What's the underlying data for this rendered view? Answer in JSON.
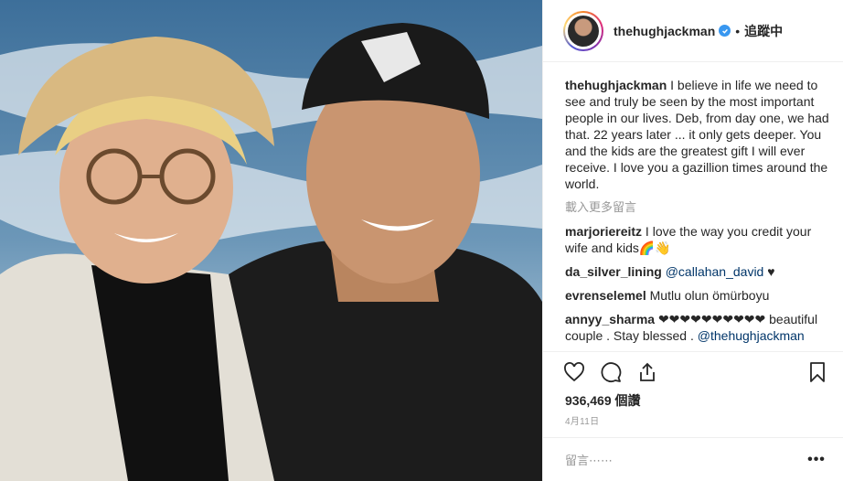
{
  "post": {
    "username": "thehughjackman",
    "follow_label": "追蹤中",
    "separator": "•",
    "caption_text": " I believe in life we need to see and truly be seen by the most important people in our lives. Deb, from day one, we had that. 22 years later ... it only gets deeper. You and the kids are the greatest gift I will ever receive. I love you a gazillion times around the world.",
    "load_more": "載入更多留言",
    "comments": [
      {
        "user": "marjoriereitz",
        "text": " I love the way you credit your wife and kids🌈👋"
      },
      {
        "user": "da_silver_lining",
        "mention": "@callahan_david",
        "text": " ♥"
      },
      {
        "user": "evrenselemel",
        "text": " Mutlu olun ömürboyu"
      },
      {
        "user": "annyy_sharma",
        "text": " ❤❤❤❤❤❤❤❤❤❤ beautiful couple . Stay blessed . ",
        "mention": "@thehughjackman"
      }
    ],
    "likes": "936,469 個讚",
    "date": "4月11日",
    "comment_placeholder": "留言⋯⋯",
    "more_label": "•••"
  },
  "icons": [
    "heart-icon",
    "comment-icon",
    "share-icon",
    "bookmark-icon",
    "verified-icon"
  ],
  "colors": {
    "verified": "#3897f0",
    "link": "#003569",
    "muted": "#999999"
  }
}
